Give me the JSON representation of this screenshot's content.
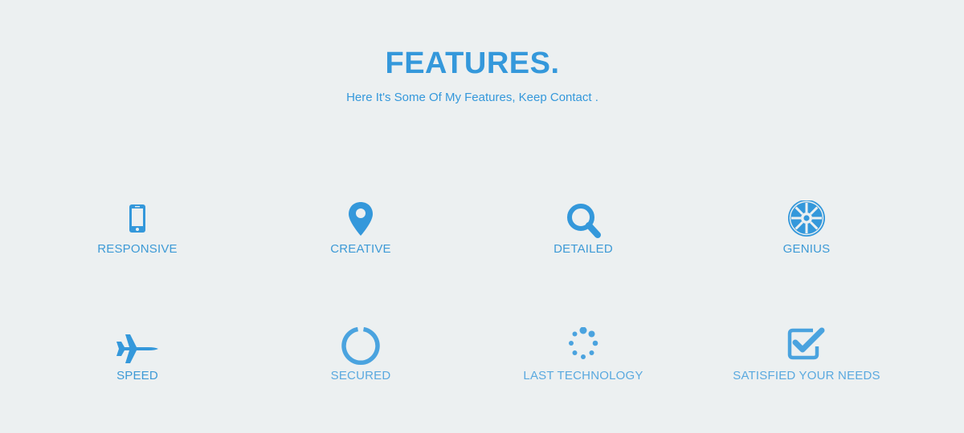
{
  "header": {
    "title": "FEATURES.",
    "subtitle": "Here It's Some Of My Features, Keep Contact ."
  },
  "colors": {
    "accent": "#3498db",
    "background": "#ecf0f1"
  },
  "features": [
    {
      "label": "RESPONSIVE",
      "icon": "mobile-phone-icon"
    },
    {
      "label": "CREATIVE",
      "icon": "map-marker-icon"
    },
    {
      "label": "DETAILED",
      "icon": "magnifier-icon"
    },
    {
      "label": "GENIUS",
      "icon": "imperial-emblem-icon"
    },
    {
      "label": "SPEED",
      "icon": "fighter-jet-icon"
    },
    {
      "label": "SECURED",
      "icon": "circle-notch-icon"
    },
    {
      "label": "LAST TECHNOLOGY",
      "icon": "spinner-icon"
    },
    {
      "label": "SATISFIED YOUR NEEDS",
      "icon": "check-square-icon"
    }
  ]
}
